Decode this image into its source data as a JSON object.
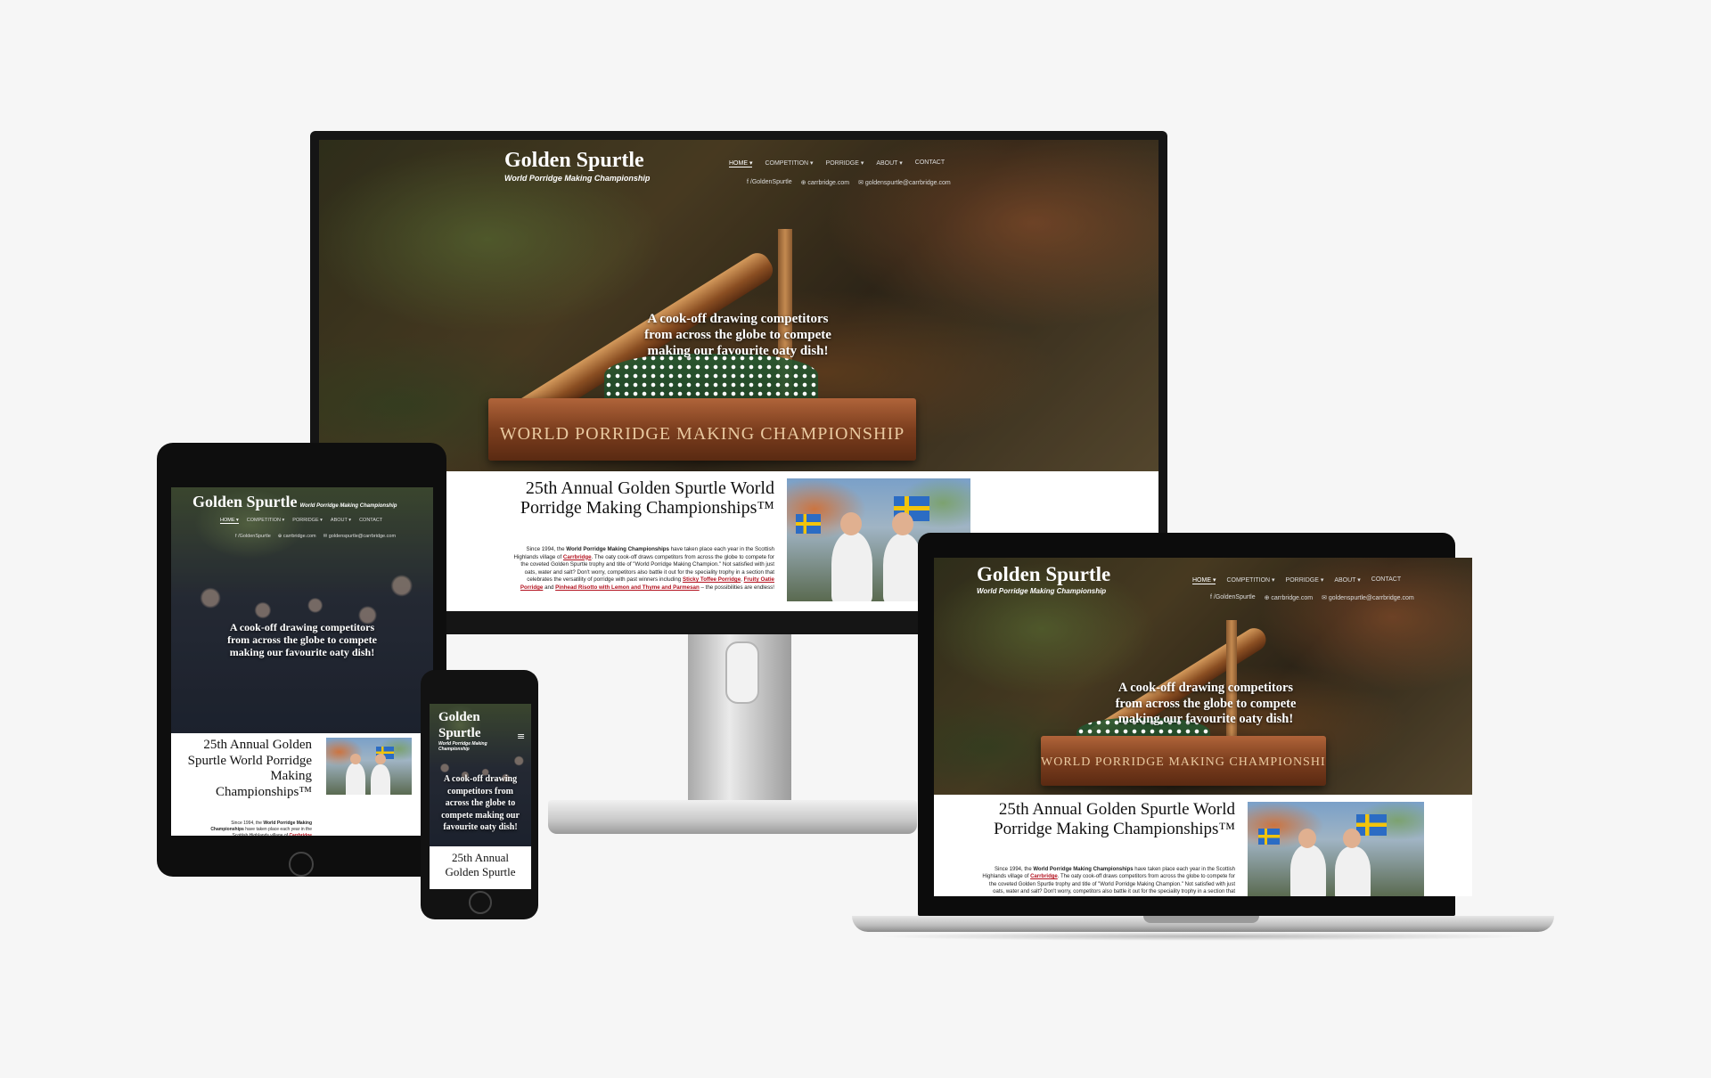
{
  "site": {
    "title": "Golden Spurtle",
    "subtitle": "World Porridge Making Championship",
    "title_line1": "Golden",
    "title_line2": "Spurtle",
    "nav": [
      "HOME ▾",
      "COMPETITION ▾",
      "PORRIDGE ▾",
      "ABOUT ▾",
      "CONTACT"
    ],
    "social": {
      "facebook": "/GoldenSpurtle",
      "web": "carrbridge.com",
      "email": "goldenspurtle@carrbridge.com"
    },
    "tagline": "A cook-off drawing competitors from across the globe to compete making our favourite oaty dish!",
    "trophy_plate": "WORLD PORRIDGE MAKING CHAMPIONSHIP",
    "heading": "25th Annual Golden Spurtle World Porridge Making Championships™",
    "tablet_heading": "25th Annual Golden Spurtle World Porridge Making Championships™",
    "phone_heading": "25th Annual Golden Spurtle",
    "intro": {
      "p1": "Since 1994, the ",
      "event": "World Porridge Making Championships",
      "p2": " have taken place each year in the Scottish Highlands village of ",
      "village": "Carrbridge",
      "p3": ". The oaty cook-off draws competitors from across the globe to compete for the coveted Golden Spurtle trophy and title of \"World Porridge Making Champion.\" Not satisfied with just oats, water and salt? Don't worry, competitors also battle it out for the speciality trophy in a section that celebrates the versatility of porridge with past winners including ",
      "w1": "Sticky Toffee Porridge",
      "sep1": ", ",
      "w2": "Fruity Oatie Porridge",
      "sep2": " and ",
      "w3": "Pinhead Risotto with Lemon and Thyme and Parmesan",
      "p4": " – the possibilities are endless!"
    }
  },
  "icons": {
    "facebook": "facebook-icon",
    "web": "globe-icon",
    "email": "envelope-icon",
    "menu": "hamburger-menu-icon"
  }
}
